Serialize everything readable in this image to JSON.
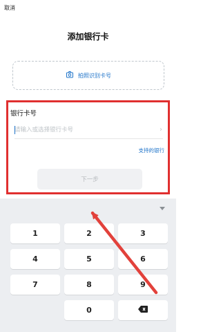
{
  "header": {
    "cancel_label": "取消",
    "title": "添加银行卡"
  },
  "scan": {
    "label": "拍照识别卡号",
    "icon": "camera-icon"
  },
  "form": {
    "field_label": "银行卡号",
    "input_placeholder": "请输入或选择银行卡号",
    "input_value": "",
    "support_link": "支持的银行",
    "next_button": "下一步"
  },
  "keyboard": {
    "keys": [
      "1",
      "2",
      "3",
      "4",
      "5",
      "6",
      "7",
      "8",
      "9",
      "0"
    ],
    "delete_icon": "backspace-icon",
    "toggle_icon": "collapse-triangle-icon"
  },
  "colors": {
    "accent": "#1e73c9",
    "highlight": "#e02f2f"
  }
}
